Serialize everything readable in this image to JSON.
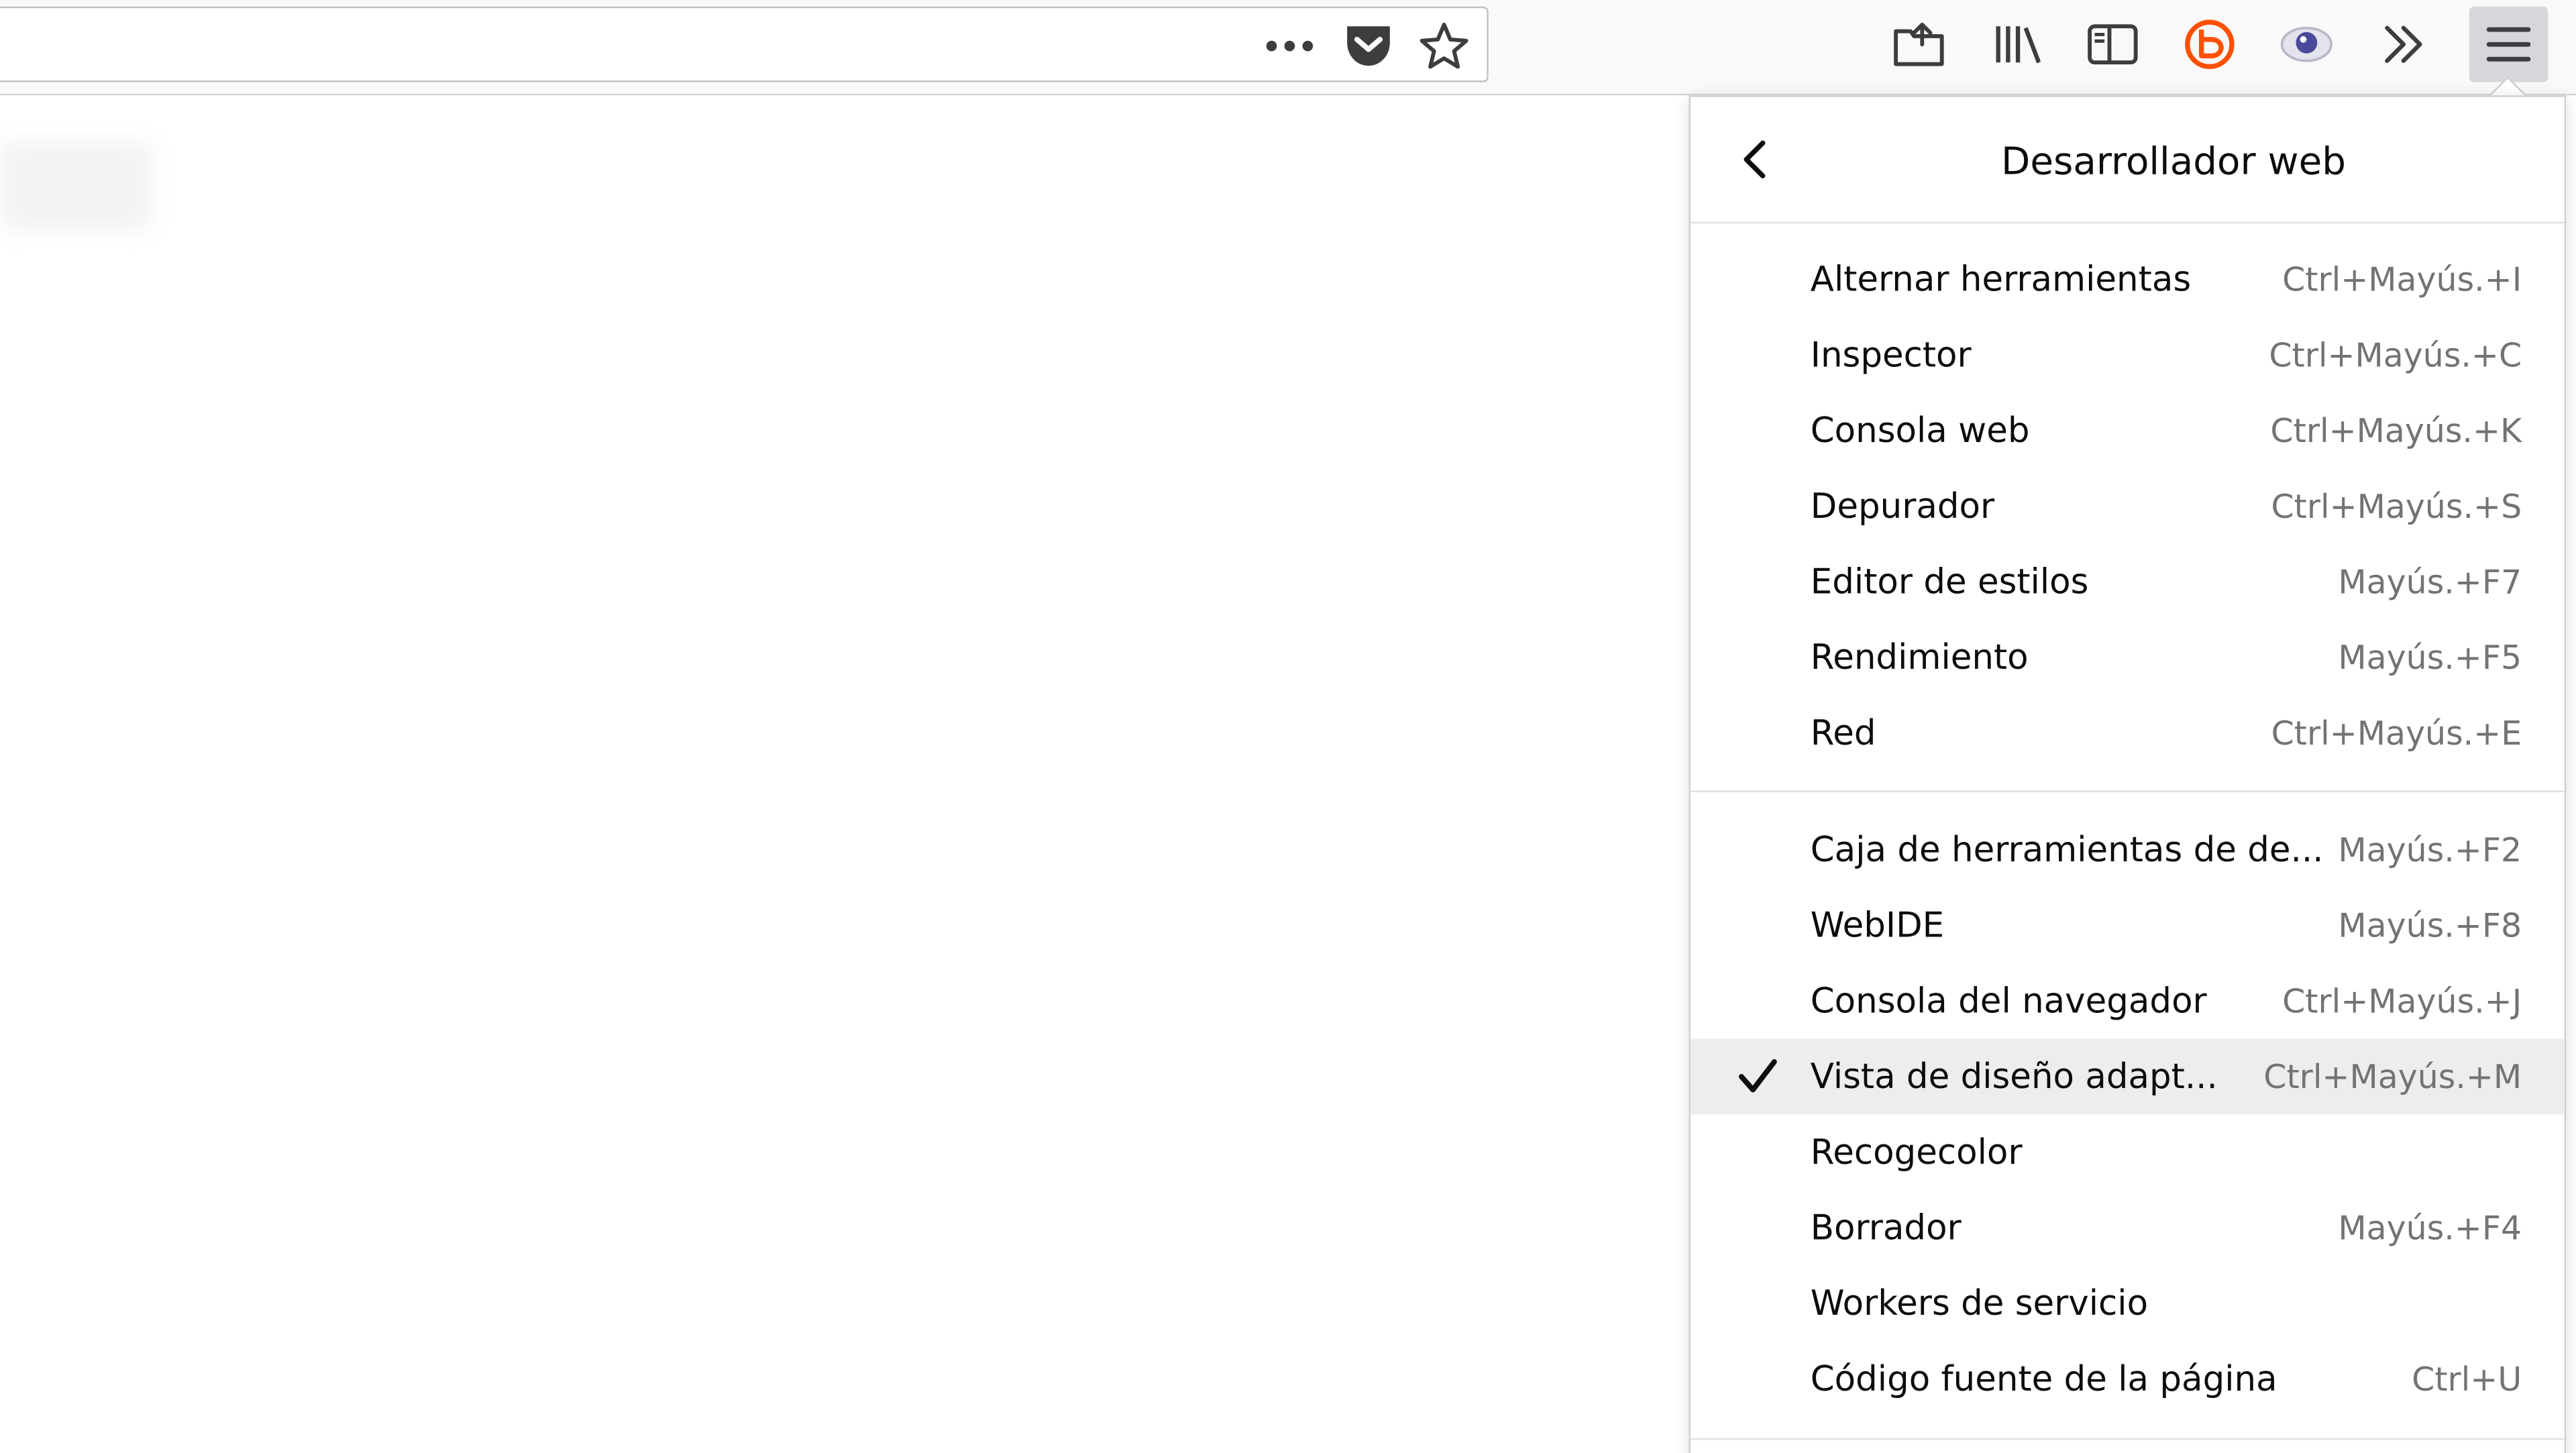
{
  "toolbar": {
    "url_icons": [
      "page-actions-icon",
      "pocket-icon",
      "bookmark-star-icon"
    ],
    "buttons": [
      "share-screenshot-icon",
      "library-icon",
      "sidebar-icon",
      "addon-orange-icon",
      "privacy-eye-icon",
      "overflow-chevrons-icon",
      "hamburger-menu-icon"
    ],
    "accent_color": "#ff4f00"
  },
  "panel": {
    "title": "Desarrollador web",
    "back_icon": "chevron-left-icon",
    "groups": [
      [
        {
          "label": "Alternar herramientas",
          "shortcut": "Ctrl+Mayús.+I"
        },
        {
          "label": "Inspector",
          "shortcut": "Ctrl+Mayús.+C"
        },
        {
          "label": "Consola web",
          "shortcut": "Ctrl+Mayús.+K"
        },
        {
          "label": "Depurador",
          "shortcut": "Ctrl+Mayús.+S"
        },
        {
          "label": "Editor de estilos",
          "shortcut": "Mayús.+F7"
        },
        {
          "label": "Rendimiento",
          "shortcut": "Mayús.+F5"
        },
        {
          "label": "Red",
          "shortcut": "Ctrl+Mayús.+E"
        }
      ],
      [
        {
          "label": "Caja de herramientas de de...",
          "shortcut": "Mayús.+F2"
        },
        {
          "label": "WebIDE",
          "shortcut": "Mayús.+F8"
        },
        {
          "label": "Consola del navegador",
          "shortcut": "Ctrl+Mayús.+J"
        },
        {
          "label": "Vista de diseño adapt...",
          "shortcut": "Ctrl+Mayús.+M",
          "checked": true
        },
        {
          "label": "Recogecolor",
          "shortcut": ""
        },
        {
          "label": "Borrador",
          "shortcut": "Mayús.+F4"
        },
        {
          "label": "Workers de servicio",
          "shortcut": ""
        },
        {
          "label": "Código fuente de la página",
          "shortcut": "Ctrl+U"
        }
      ]
    ]
  }
}
